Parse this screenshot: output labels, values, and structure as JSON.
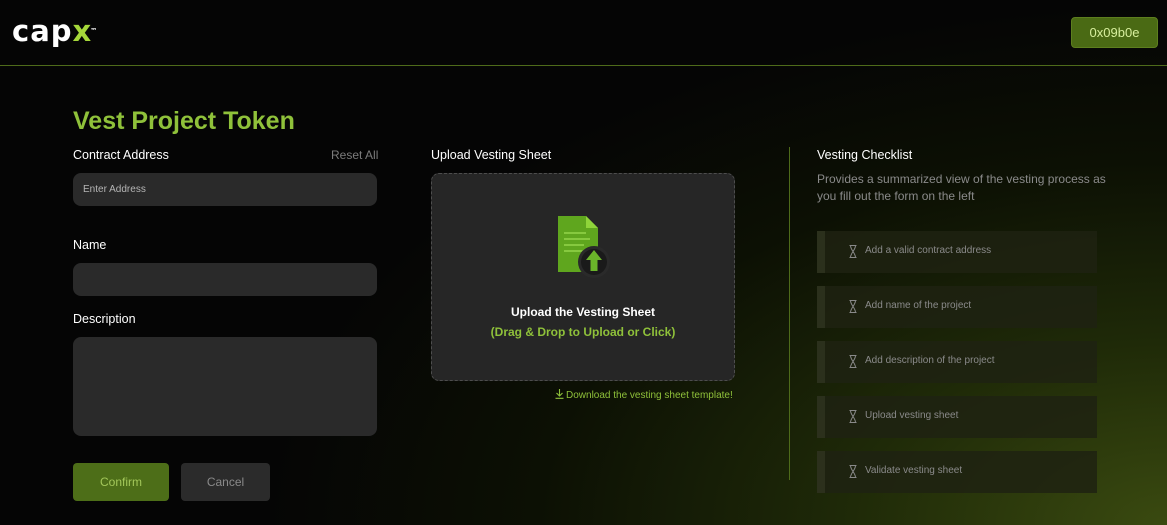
{
  "header": {
    "logo_text": "capx",
    "logo_tm": "™",
    "wallet_address": "0x09b0e"
  },
  "page": {
    "title": "Vest Project Token"
  },
  "form": {
    "contract_label": "Contract Address",
    "reset_label": "Reset All",
    "contract_placeholder": "Enter Address",
    "contract_value": "",
    "name_label": "Name",
    "name_value": "",
    "description_label": "Description",
    "description_value": "",
    "confirm_label": "Confirm",
    "cancel_label": "Cancel"
  },
  "upload": {
    "section_label": "Upload Vesting Sheet",
    "title": "Upload the Vesting Sheet",
    "subtitle": "(Drag & Drop to Upload or Click)",
    "download_link": "Download the vesting sheet template!",
    "icon": "upload-document-icon"
  },
  "checklist": {
    "title": "Vesting Checklist",
    "description": "Provides a summarized view of the vesting process as you fill out the form on the left",
    "items": [
      {
        "label": "Add a valid contract address",
        "icon": "hourglass-icon"
      },
      {
        "label": "Add name of the project",
        "icon": "hourglass-icon"
      },
      {
        "label": "Add description of the project",
        "icon": "hourglass-icon"
      },
      {
        "label": "Upload vesting sheet",
        "icon": "hourglass-icon"
      },
      {
        "label": "Validate vesting sheet",
        "icon": "hourglass-icon"
      }
    ]
  },
  "colors": {
    "accent": "#8fc13a",
    "button_green": "#4d6e18",
    "background": "#050505"
  }
}
